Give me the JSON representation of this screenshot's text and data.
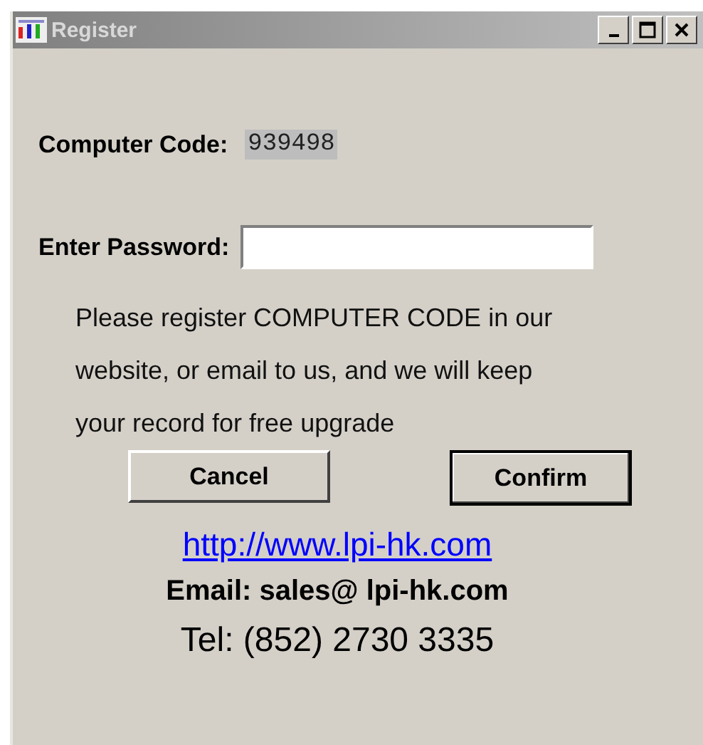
{
  "window": {
    "title": "Register"
  },
  "computer_code": {
    "label": "Computer Code:",
    "value": "939498"
  },
  "password": {
    "label": "Enter Password:"
  },
  "notice": [
    "Please register  COMPUTER CODE in our",
    "website, or email to us, and we will keep",
    "your record for free upgrade"
  ],
  "buttons": [
    {
      "label": "Cancel",
      "default": false
    },
    {
      "label": "Confirm",
      "default": true
    }
  ],
  "website": "http://www.lpi-hk.com",
  "email": "Email: sales@ lpi-hk.com",
  "tel": "Tel: (852) 2730 3335"
}
